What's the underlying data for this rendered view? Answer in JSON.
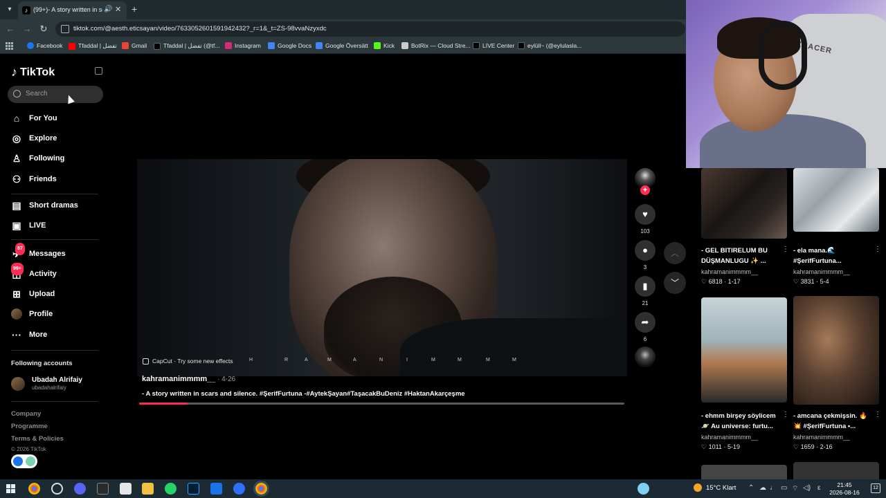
{
  "browser": {
    "tab_title": "(99+)- A story written in sca",
    "tab_favicon": "tiktok-icon",
    "url": "tiktok.com/@aesth.eticsayan/video/7633052601591942432?_r=1&_t=ZS-98vvaNzyxdc",
    "bookmarks": [
      {
        "label": "Facebook",
        "icon": "facebook-icon",
        "color": "#1877f2"
      },
      {
        "label": "Tfaddal | تفضل",
        "icon": "youtube-icon",
        "color": "#ff0000"
      },
      {
        "label": "Gmail",
        "icon": "gmail-icon",
        "color": "#ea4335"
      },
      {
        "label": "Tfaddal | تفضل (@tf...",
        "icon": "tiktok-icon",
        "color": "#000000"
      },
      {
        "label": "Instagram",
        "icon": "instagram-icon",
        "color": "#d62976"
      },
      {
        "label": "Google Docs",
        "icon": "docs-icon",
        "color": "#4285f4"
      },
      {
        "label": "Google Översätt",
        "icon": "translate-icon",
        "color": "#4285f4"
      },
      {
        "label": "Kick",
        "icon": "kick-icon",
        "color": "#53fc18"
      },
      {
        "label": "BotRix — Cloud Stre...",
        "icon": "botrix-icon",
        "color": "#cccccc"
      },
      {
        "label": "LIVE Center",
        "icon": "tiktok-icon",
        "color": "#000000"
      },
      {
        "label": "eylüll~ (@eylulasla...",
        "icon": "tiktok-icon",
        "color": "#000000"
      }
    ]
  },
  "sidebar": {
    "logo": "TikTok",
    "search_placeholder": "Search",
    "nav": [
      {
        "label": "For You",
        "icon": "home-icon"
      },
      {
        "label": "Explore",
        "icon": "compass-icon"
      },
      {
        "label": "Following",
        "icon": "following-icon"
      },
      {
        "label": "Friends",
        "icon": "friends-icon"
      },
      {
        "label": "Short dramas",
        "icon": "drama-icon"
      },
      {
        "label": "LIVE",
        "icon": "live-icon"
      },
      {
        "label": "Messages",
        "icon": "messages-icon",
        "badge": "87"
      },
      {
        "label": "Activity",
        "icon": "activity-icon",
        "badge": "99+"
      },
      {
        "label": "Upload",
        "icon": "upload-icon"
      },
      {
        "label": "Profile",
        "icon": "avatar-icon"
      },
      {
        "label": "More",
        "icon": "more-icon"
      }
    ],
    "following_title": "Following accounts",
    "following": [
      {
        "name": "Ubadah Alrifaiy",
        "handle": "ubadahalrifaiy"
      }
    ],
    "footer_links": [
      "Company",
      "Programme",
      "Terms & Policies"
    ],
    "copyright": "© 2026 TikTok"
  },
  "video": {
    "capcut_label": "CapCut · Try some new effects",
    "watermark_letters": [
      "H",
      "R",
      "A",
      "M",
      "A",
      "N",
      "I",
      "M",
      "M",
      "M",
      "M"
    ],
    "author": "kahramanimmmm__",
    "date": "· 4-26",
    "description": "- A story written in scars and silence. #ŞerifFurtuna -#AytekŞayan#TaşacakBuDeniz #HaktanAkarçeşme",
    "progress": 0.1,
    "likes": "103",
    "comments": "3",
    "saves": "21",
    "shares": "6"
  },
  "webcam": {
    "chair_brand": "DXRACER"
  },
  "related": [
    {
      "title": "- GEL BITIRELUM BU DÜŞMANLUGU ✨ ...",
      "author": "kahramanimmmm__",
      "likes": "6818",
      "date": "1-17"
    },
    {
      "title": "- ela mana.🌊 #ŞerifFurtuna...",
      "author": "kahramanimmmm__",
      "likes": "3831",
      "date": "5-4"
    },
    {
      "title": "- ehmm birşey söylicem 🪐 Au universe: furtu...",
      "author": "kahramanimmmm__",
      "likes": "1011",
      "date": "5-19"
    },
    {
      "title": "- amcana çekmişsin. 🔥 💥 #ŞerifFurtuna •...",
      "author": "kahramanimmmm__",
      "likes": "1659",
      "date": "2-16"
    }
  ],
  "taskbar": {
    "weather": "15°C  Klart",
    "time": "21:45",
    "date": "2026-08-16",
    "notifications": "12"
  }
}
